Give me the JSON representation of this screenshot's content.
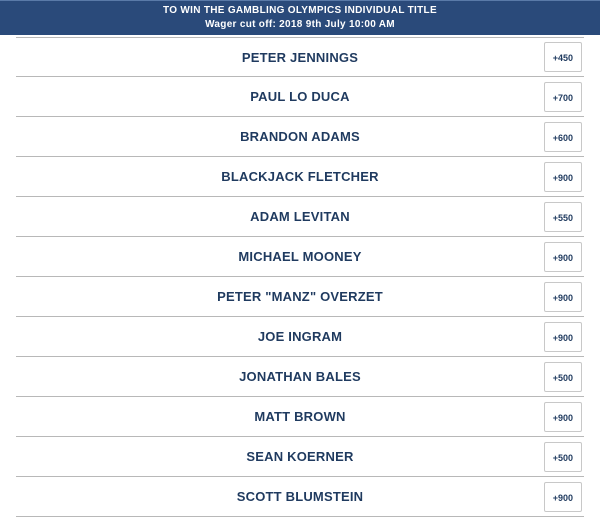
{
  "header": {
    "title": "TO WIN THE GAMBLING OLYMPICS INDIVIDUAL TITLE",
    "cutoff": "Wager cut off: 2018 9th July 10:00 AM"
  },
  "entries": [
    {
      "name": "PETER JENNINGS",
      "odds": "+450"
    },
    {
      "name": "PAUL LO DUCA",
      "odds": "+700"
    },
    {
      "name": "BRANDON ADAMS",
      "odds": "+600"
    },
    {
      "name": "BLACKJACK FLETCHER",
      "odds": "+900"
    },
    {
      "name": "ADAM LEVITAN",
      "odds": "+550"
    },
    {
      "name": "MICHAEL MOONEY",
      "odds": "+900"
    },
    {
      "name": "PETER \"MANZ\" OVERZET",
      "odds": "+900"
    },
    {
      "name": "JOE INGRAM",
      "odds": "+900"
    },
    {
      "name": "JONATHAN BALES",
      "odds": "+500"
    },
    {
      "name": "MATT BROWN",
      "odds": "+900"
    },
    {
      "name": "SEAN KOERNER",
      "odds": "+500"
    },
    {
      "name": "SCOTT BLUMSTEIN",
      "odds": "+900"
    }
  ]
}
